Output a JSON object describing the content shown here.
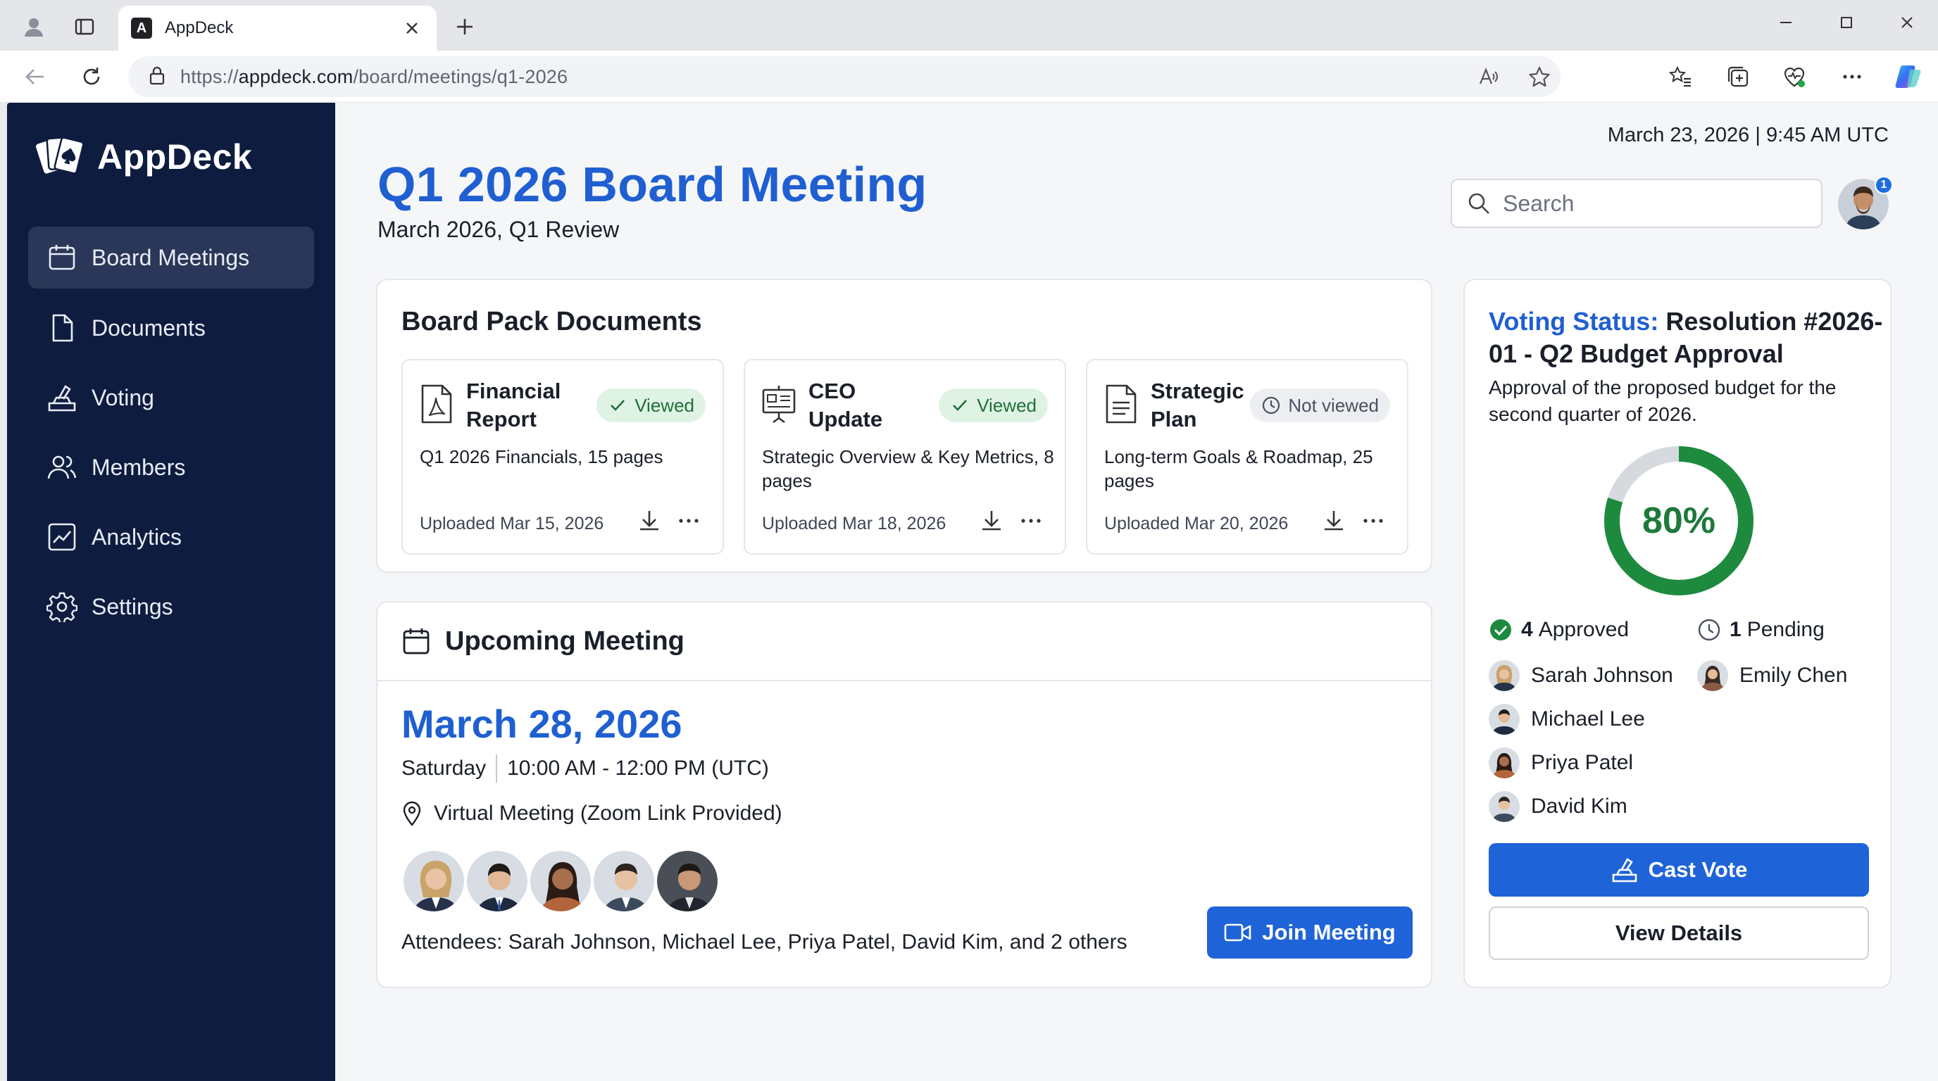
{
  "browser": {
    "tab_title": "AppDeck",
    "tab_favicon": "A",
    "url_prefix": "https://",
    "url_domain": "appdeck.com",
    "url_path": "/board/meetings/q1-2026"
  },
  "sidebar": {
    "brand": "AppDeck",
    "items": [
      {
        "label": "Board Meetings",
        "icon": "calendar-icon",
        "active": true
      },
      {
        "label": "Documents",
        "icon": "document-icon"
      },
      {
        "label": "Voting",
        "icon": "vote-icon"
      },
      {
        "label": "Members",
        "icon": "members-icon"
      },
      {
        "label": "Analytics",
        "icon": "analytics-icon"
      },
      {
        "label": "Settings",
        "icon": "gear-icon"
      }
    ]
  },
  "header": {
    "datetime": "March 23, 2026 | 9:45 AM UTC",
    "title": "Q1 2026 Board Meeting",
    "subtitle": "March 2026, Q1 Review",
    "search_placeholder": "Search",
    "notification_count": "1"
  },
  "board_pack": {
    "title": "Board Pack Documents",
    "documents": [
      {
        "name": "Financial Report",
        "status": "Viewed",
        "viewed": true,
        "description": "Q1 2026 Financials, 15 pages",
        "uploaded": "Uploaded Mar 15, 2026",
        "icon": "pdf-icon"
      },
      {
        "name": "CEO Update",
        "status": "Viewed",
        "viewed": true,
        "description": "Strategic Overview & Key Metrics, 8 pages",
        "uploaded": "Uploaded Mar 18, 2026",
        "icon": "presentation-icon"
      },
      {
        "name": "Strategic Plan",
        "status": "Not viewed",
        "viewed": false,
        "description": "Long-term Goals & Roadmap, 25 pages",
        "uploaded": "Uploaded Mar 20, 2026",
        "icon": "document-icon"
      }
    ]
  },
  "upcoming": {
    "title": "Upcoming Meeting",
    "date": "March 28, 2026",
    "day": "Saturday",
    "time": "10:00 AM - 12:00 PM (UTC)",
    "location": "Virtual Meeting (Zoom Link Provided)",
    "attendees_text": "Attendees: Sarah Johnson, Michael Lee, Priya Patel, David Kim, and 2 others",
    "join_label": "Join Meeting"
  },
  "voting": {
    "title_prefix": "Voting Status:",
    "title_rest": " Resolution #2026-01 - Q2 Budget Approval",
    "description": "Approval of the proposed budget for the second quarter of 2026.",
    "percent_label": "80%",
    "percent_value": 80,
    "approved_count": "4",
    "approved_label": "Approved",
    "pending_count": "1",
    "pending_label": "Pending",
    "approved_voters": [
      "Sarah Johnson",
      "Michael Lee",
      "Priya Patel",
      "David Kim"
    ],
    "pending_voters": [
      "Emily Chen"
    ],
    "cast_label": "Cast Vote",
    "details_label": "View Details",
    "colors": {
      "approved": "#1d8a3e",
      "pending": "#d6d9de"
    }
  }
}
